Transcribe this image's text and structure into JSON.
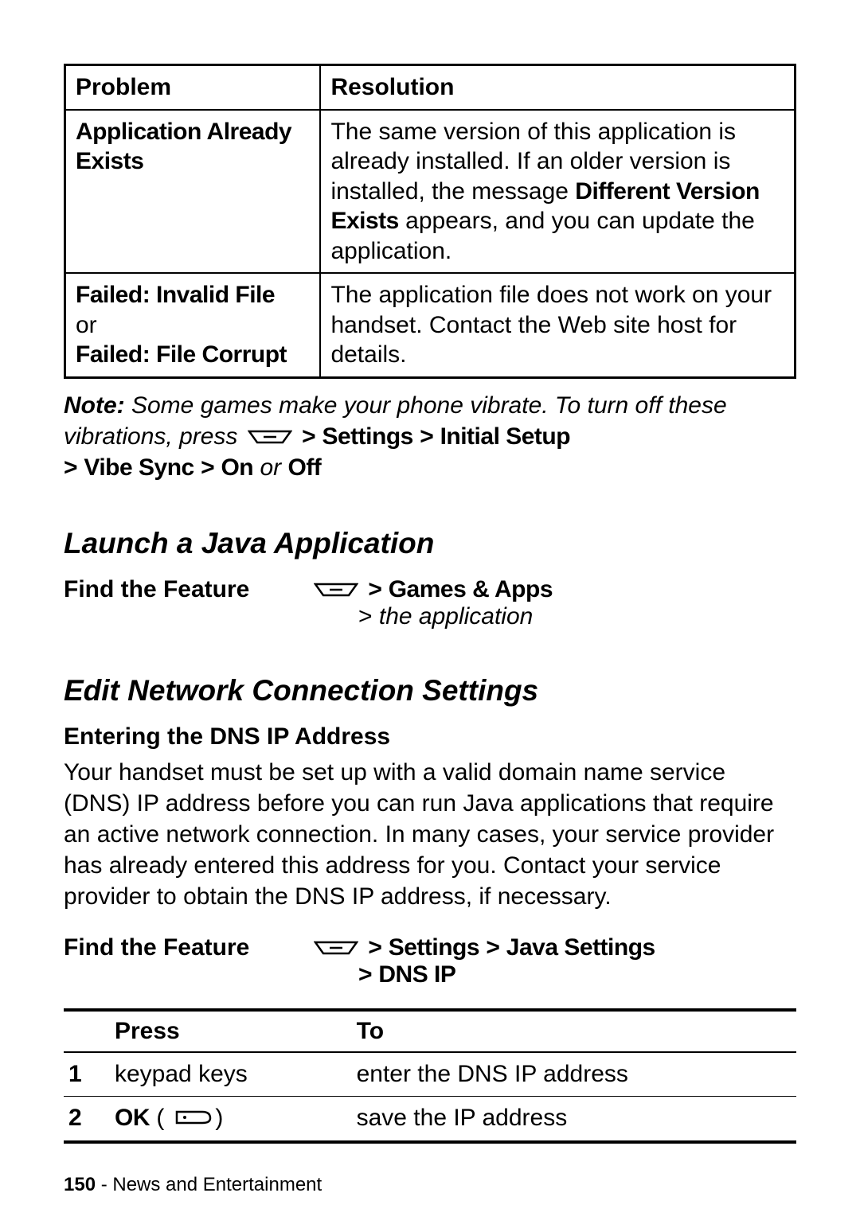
{
  "table1": {
    "headers": {
      "col1": "Problem",
      "col2": "Resolution"
    },
    "rows": [
      {
        "problem": "Application Already Exists",
        "resolution_pre": "The same version of this application is already installed. If an older version is installed, the message ",
        "resolution_bold": "Different Version Exists",
        "resolution_post": " appears, and you can update the application."
      },
      {
        "problem_line1": "Failed: Invalid File",
        "problem_or": "or",
        "problem_line2": "Failed: File Corrupt",
        "resolution": "The application file does not work on your handset. Contact the Web site host for details."
      }
    ]
  },
  "note": {
    "label": "Note:",
    "text1": " Some games make your phone vibrate. To turn off these vibrations, press ",
    "path1": "Settings",
    "path2": "Initial Setup",
    "path3": "Vibe Sync",
    "path4": "On",
    "or": " or ",
    "path5": "Off"
  },
  "section1": {
    "title": "Launch a Java Application",
    "feature_label": "Find the Feature",
    "path1": "Games & Apps",
    "path2_prefix": "> ",
    "path2_text": "the application"
  },
  "section2": {
    "title": "Edit Network Connection Settings",
    "sub": "Entering the DNS IP Address",
    "body": "Your handset must be set up with a valid domain name service (DNS) IP address before you can run Java applications that require an active network connection. In many cases, your service provider has already entered this address for you. Contact your service provider to obtain the DNS IP address, if necessary.",
    "feature_label": "Find the Feature",
    "path1": "Settings",
    "path2": "Java Settings",
    "path3": "DNS IP"
  },
  "steps": {
    "headers": {
      "press": "Press",
      "to": "To"
    },
    "rows": [
      {
        "num": "1",
        "press": "keypad keys",
        "to": "enter the DNS IP address"
      },
      {
        "num": "2",
        "press_pre": "OK",
        "press_post_open": "(",
        "press_post_close": ")",
        "to": "save the IP address"
      }
    ]
  },
  "footer": {
    "page": "150",
    "sep": " - ",
    "section": "News and Entertainment"
  },
  "glyphs": {
    "gt": ">"
  }
}
